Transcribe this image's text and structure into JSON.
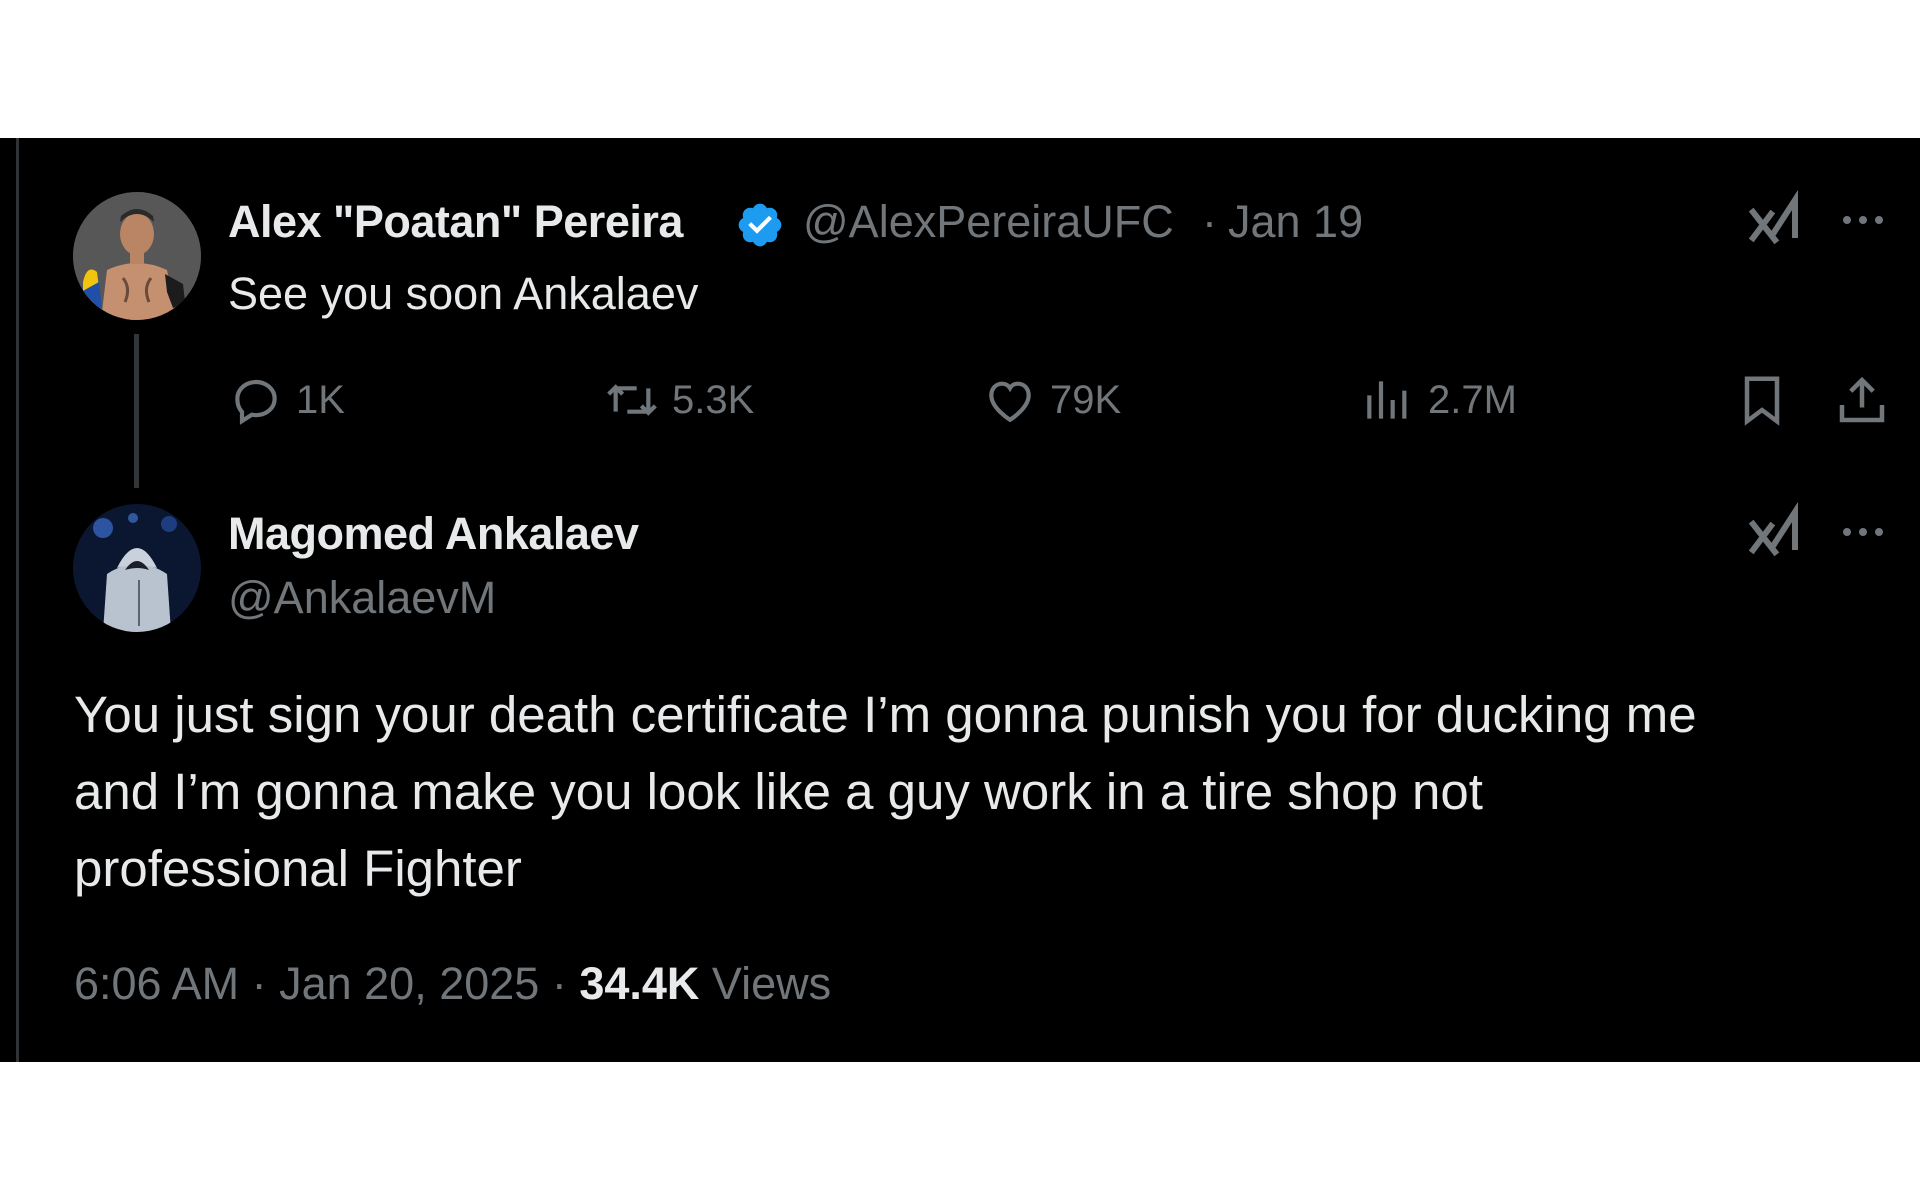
{
  "original_tweet": {
    "author_name": "Alex \"Poatan\" Pereira",
    "handle": "@AlexPereiraUFC",
    "separator": "·",
    "date": "Jan 19",
    "text": "See you soon Ankalaev",
    "verified": true,
    "actions": {
      "replies": "1K",
      "reposts": "5.3K",
      "likes": "79K",
      "views": "2.7M"
    }
  },
  "reply_tweet": {
    "author_name": "Magomed Ankalaev",
    "handle": "@AnkalaevM",
    "text_lines": [
      "You just sign your death certificate I’m gonna punish you for ducking me",
      "and I’m gonna make you look like a guy work in a tire shop not",
      "professional Fighter"
    ],
    "timestamp": "6:06 AM · Jan 20, 2025 · ",
    "views_count": "34.4K",
    "views_label": " Views"
  },
  "icons": {
    "reply": "reply-icon",
    "repost": "repost-icon",
    "like": "heart-icon",
    "views": "analytics-icon",
    "bookmark": "bookmark-icon",
    "share": "share-icon",
    "grok": "grok-icon",
    "more": "more-icon",
    "verified": "verified-badge-icon"
  },
  "colors": {
    "background": "#000000",
    "text_primary": "#e7e9ea",
    "text_secondary": "#71767b",
    "verified_blue": "#1d9bf0"
  }
}
